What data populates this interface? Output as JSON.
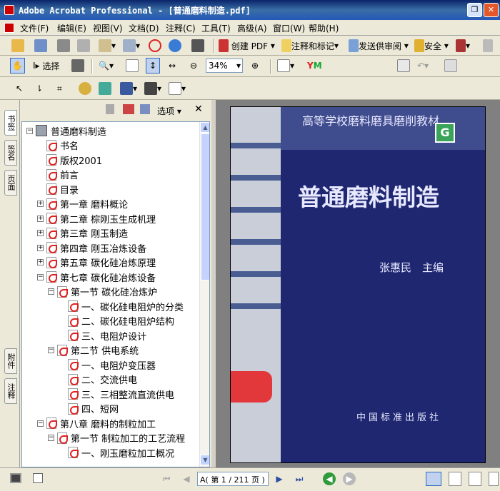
{
  "window": {
    "title": "Adobe Acrobat Professional - [普通磨料制造.pdf]"
  },
  "menubar": [
    "文件(F)",
    "编辑(E)",
    "视图(V)",
    "文档(D)",
    "注释(C)",
    "工具(T)",
    "高级(A)",
    "窗口(W)",
    "帮助(H)"
  ],
  "toolbar1": {
    "create_pdf": "创建 PDF",
    "comment_markup": "注释和标记",
    "send_review": "发送供审阅",
    "secure": "安全"
  },
  "toolbar2": {
    "select": "选择",
    "zoom": "34%"
  },
  "sidebar_tabs": {
    "bookmarks": "书签",
    "signatures": "签名",
    "pages": "页面",
    "attachments": "附件",
    "comments": "注释"
  },
  "bookmark_panel": {
    "options": "选项"
  },
  "bookmarks": [
    {
      "label": "普通磨料制造",
      "level": 0,
      "expander": "−",
      "root": true
    },
    {
      "label": "书名",
      "level": 1
    },
    {
      "label": "版权2001",
      "level": 1
    },
    {
      "label": "前言",
      "level": 1
    },
    {
      "label": "目录",
      "level": 1
    },
    {
      "label": "第一章 磨料概论",
      "level": 1,
      "expander": "+"
    },
    {
      "label": "第二章 棕刚玉生成机理",
      "level": 1,
      "expander": "+"
    },
    {
      "label": "第三章 刚玉制造",
      "level": 1,
      "expander": "+"
    },
    {
      "label": "第四章 刚玉冶炼设备",
      "level": 1,
      "expander": "+"
    },
    {
      "label": "第五章 碳化硅冶炼原理",
      "level": 1,
      "expander": "+"
    },
    {
      "label": "第七章 碳化硅冶炼设备",
      "level": 1,
      "expander": "−"
    },
    {
      "label": "第一节 碳化硅冶炼炉",
      "level": 2,
      "expander": "−"
    },
    {
      "label": "一、碳化硅电阻炉的分类",
      "level": 3
    },
    {
      "label": "二、碳化硅电阻炉结构",
      "level": 3
    },
    {
      "label": "三、电阻炉设计",
      "level": 3
    },
    {
      "label": "第二节 供电系统",
      "level": 2,
      "expander": "−"
    },
    {
      "label": "一、电阻炉变压器",
      "level": 3
    },
    {
      "label": "二、交流供电",
      "level": 3
    },
    {
      "label": "三、三相整流直流供电",
      "level": 3
    },
    {
      "label": "四、短网",
      "level": 3
    },
    {
      "label": "第八章 磨料的制粒加工",
      "level": 1,
      "expander": "−"
    },
    {
      "label": "第一节 制粒加工的工艺流程",
      "level": 2,
      "expander": "−"
    },
    {
      "label": "一、刚玉磨粒加工概况",
      "level": 3
    }
  ],
  "document_page": {
    "series_title": "高等学校磨料磨具磨削教材",
    "book_title": "普通磨料制造",
    "author": "张惠民　主编",
    "publisher": "中国标准出版社",
    "logo_letter": "G"
  },
  "statusbar": {
    "page_input": "A( 第 1",
    "page_total": "/ 211 页 )"
  }
}
